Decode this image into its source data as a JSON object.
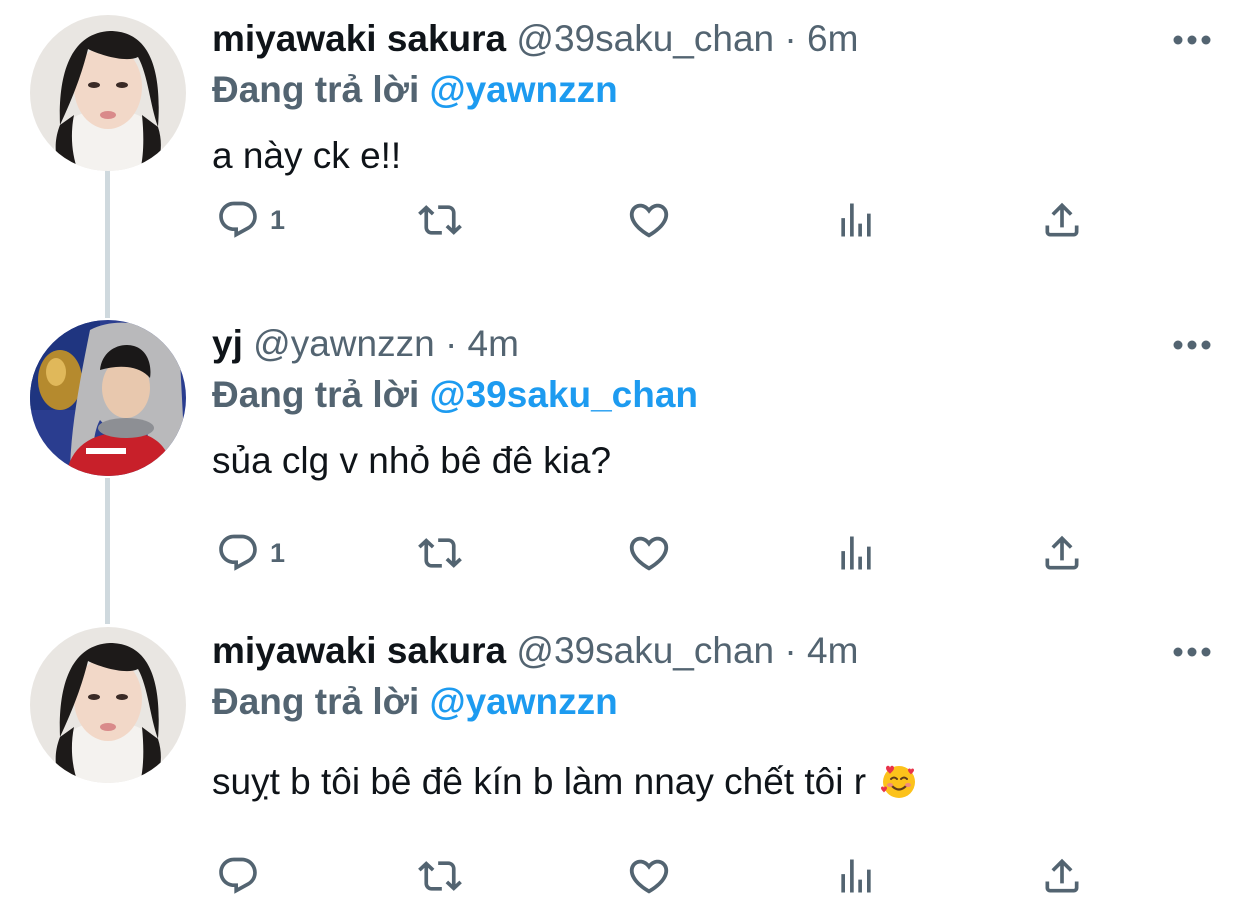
{
  "colors": {
    "text_primary": "#0f1419",
    "text_secondary": "#536471",
    "link": "#1d9bf0",
    "thread_line": "#cfd9de"
  },
  "tweets": [
    {
      "display_name": "miyawaki sakura",
      "handle": "@39saku_chan",
      "separator": "·",
      "time": "6m",
      "replying_prefix": "Đang trả lời",
      "replying_to": "@yawnzzn",
      "text": "a này ck e!!",
      "reply_count": "1",
      "avatar": "avatar-miyawaki-sakura"
    },
    {
      "display_name": "yj",
      "handle": "@yawnzzn",
      "separator": "·",
      "time": "4m",
      "replying_prefix": "Đang trả lời",
      "replying_to": "@39saku_chan",
      "text": "sủa clg v nhỏ bê đê kia?",
      "reply_count": "1",
      "avatar": "avatar-yj"
    },
    {
      "display_name": "miyawaki sakura",
      "handle": "@39saku_chan",
      "separator": "·",
      "time": "4m",
      "replying_prefix": "Đang trả lời",
      "replying_to": "@yawnzzn",
      "text": "suỵt b tôi bê đê kín b làm nnay chết tôi r",
      "emoji": "smiling-face-with-hearts-emoji",
      "reply_count": "",
      "avatar": "avatar-miyawaki-sakura"
    }
  ],
  "icons": {
    "more": "more-icon",
    "reply": "reply-icon",
    "retweet": "retweet-icon",
    "like": "like-icon",
    "views": "views-icon",
    "share": "share-icon"
  }
}
